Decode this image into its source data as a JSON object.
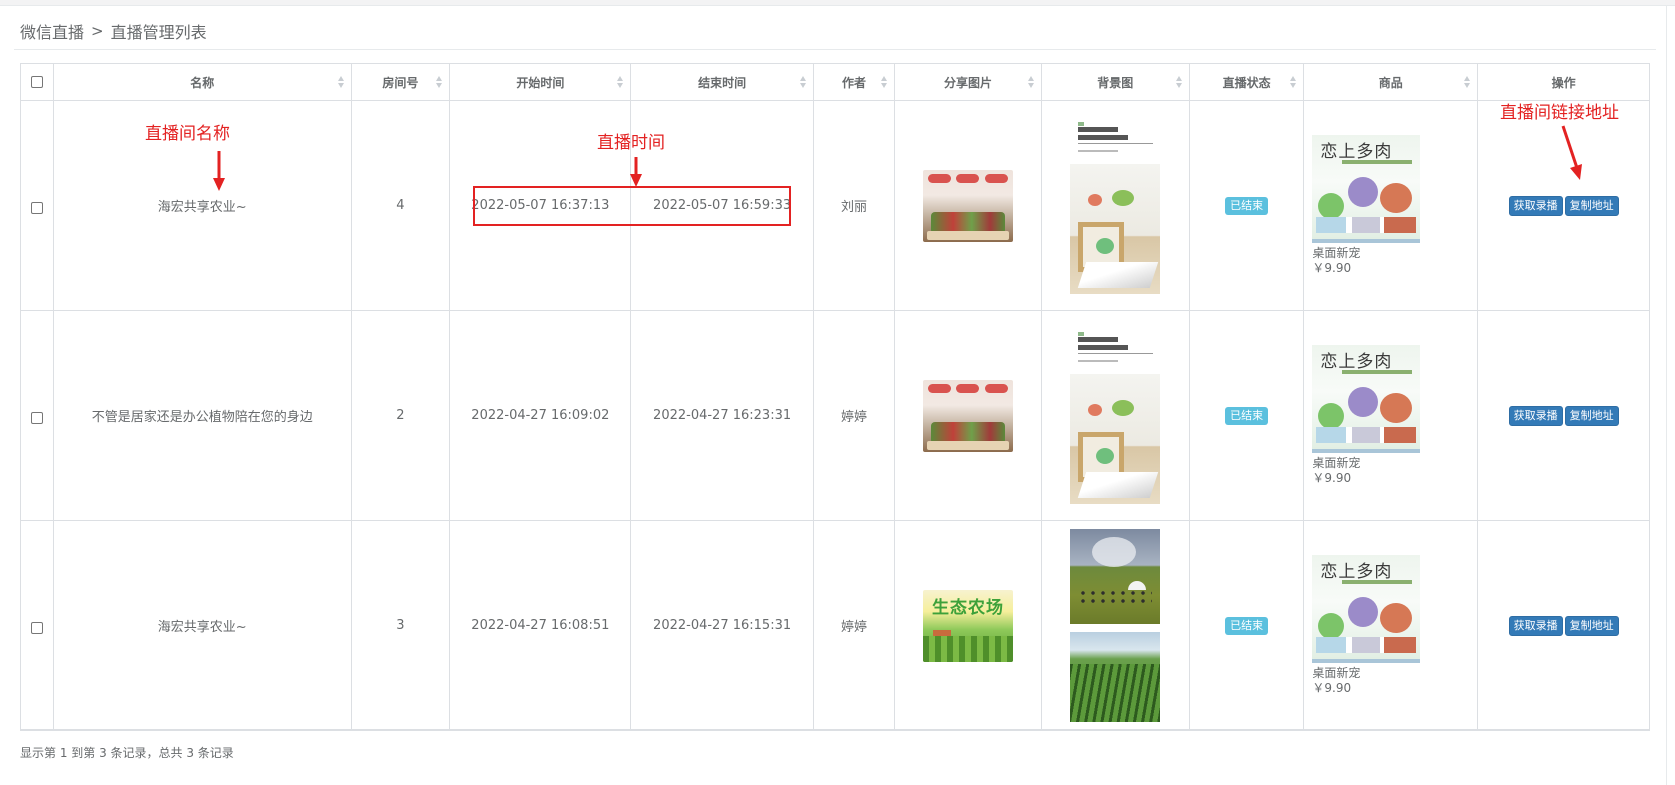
{
  "breadcrumb": {
    "root": "微信直播",
    "separator": ">",
    "current": "直播管理列表"
  },
  "table": {
    "columns": [
      "名称",
      "房间号",
      "开始时间",
      "结束时间",
      "作者",
      "分享图片",
      "背景图",
      "直播状态",
      "商品",
      "操作"
    ],
    "rows": [
      {
        "name": "海宏共享农业~",
        "room": "4",
        "start": "2022-05-07 16:37:13",
        "end": "2022-05-07 16:59:33",
        "author": "刘丽",
        "status": "已结束",
        "goods_title": "恋上多肉",
        "goods_name": "桌面新宠",
        "goods_price": "￥9.90"
      },
      {
        "name": "不管是居家还是办公植物陪在您的身边",
        "room": "2",
        "start": "2022-04-27 16:09:02",
        "end": "2022-04-27 16:23:31",
        "author": "婷婷",
        "status": "已结束",
        "goods_title": "恋上多肉",
        "goods_name": "桌面新宠",
        "goods_price": "￥9.90"
      },
      {
        "name": "海宏共享农业~",
        "room": "3",
        "start": "2022-04-27 16:08:51",
        "end": "2022-04-27 16:15:31",
        "author": "婷婷",
        "status": "已结束",
        "goods_title": "恋上多肉",
        "goods_name": "桌面新宠",
        "goods_price": "￥9.90"
      }
    ],
    "share_image_text": "生态农场",
    "actions": {
      "record": "获取录播",
      "copy": "复制地址"
    }
  },
  "annotations": {
    "name": "直播间名称",
    "time": "直播时间",
    "link": "直播间链接地址"
  },
  "footer": "显示第 1 到第 3 条记录，总共 3 条记录",
  "colors": {
    "annotation": "#e32222",
    "primary_button": "#337ab7",
    "status_badge": "#5bc0de",
    "text": "#676a6c"
  }
}
